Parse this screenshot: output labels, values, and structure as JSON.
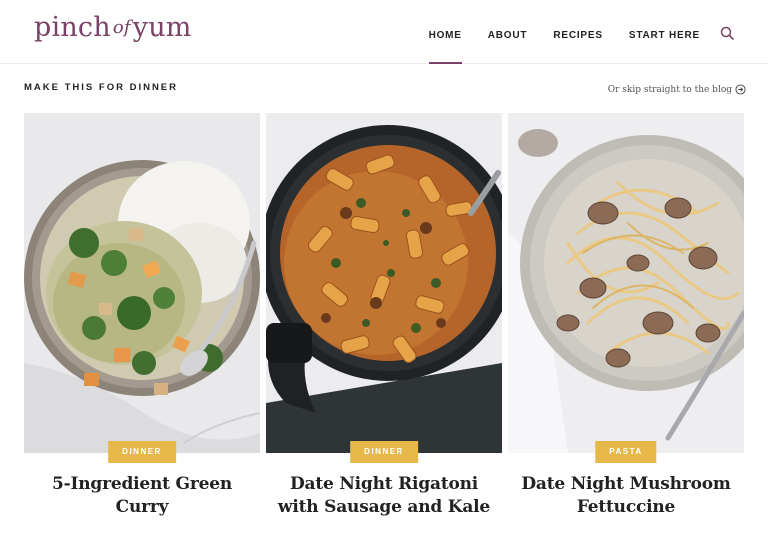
{
  "brand": {
    "logo_part1": "pinch",
    "logo_part2": "of",
    "logo_part3": "yum",
    "color": "#7a4266"
  },
  "nav": {
    "items": [
      {
        "label": "HOME",
        "active": true
      },
      {
        "label": "ABOUT",
        "active": false
      },
      {
        "label": "RECIPES",
        "active": false
      },
      {
        "label": "START HERE",
        "active": false
      }
    ],
    "search_icon": "search-icon"
  },
  "section": {
    "title": "MAKE THIS FOR DINNER",
    "skip_label": "Or skip straight to the blog",
    "skip_icon": "arrow-right-circle-icon"
  },
  "recipes": [
    {
      "category": "DINNER",
      "title": "5-Ingredient Green Curry",
      "image": "green curry with tofu and rice in a bowl"
    },
    {
      "category": "DINNER",
      "title": "Date Night Rigatoni with Sausage and Kale",
      "image": "rigatoni with sausage in a black pan"
    },
    {
      "category": "PASTA",
      "title": "Date Night Mushroom Fettuccine",
      "image": "mushroom fettuccine on a plate"
    }
  ],
  "colors": {
    "badge": "#e6b84a",
    "accent": "#7a4266"
  }
}
